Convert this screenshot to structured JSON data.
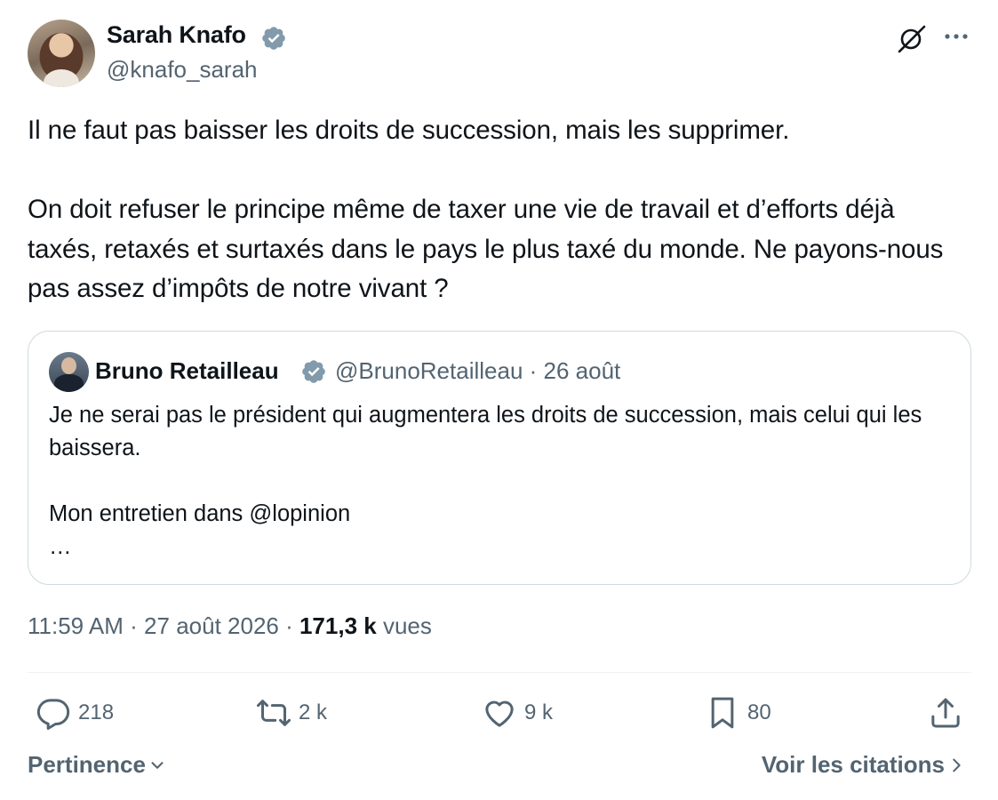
{
  "author": {
    "name": "Sarah Knafo",
    "handle": "@knafo_sarah"
  },
  "tweet": {
    "paragraphs": [
      "Il ne faut pas baisser les droits de succession, mais les supprimer.",
      "On doit refuser le principe même de taxer une vie de travail et d’efforts déjà taxés, retaxés et surtaxés dans le pays le plus taxé du monde. Ne payons-nous pas assez d’impôts de notre vivant ?"
    ]
  },
  "quoted": {
    "name": "Bruno Retailleau",
    "handle": "@BrunoRetailleau",
    "date": "26 août",
    "separator": " · ",
    "lines": [
      "Je ne serai pas le président qui augmentera les droits de succession, mais celui qui les baissera.",
      "Mon entretien dans @lopinion",
      "…"
    ]
  },
  "meta": {
    "time": "11:59 AM",
    "date": "27 août 2026",
    "views_count": "171,3 k",
    "views_label": "vues",
    "separator": " · "
  },
  "actions": {
    "replies": "218",
    "reposts": "2 k",
    "likes": "9 k",
    "bookmarks": "80"
  },
  "footer": {
    "sort_label": "Pertinence",
    "quotes_link": "Voir les citations"
  },
  "colors": {
    "text_primary": "#0f1419",
    "text_secondary": "#536471",
    "verified_badge": "#829aab",
    "border": "#cfd9de"
  },
  "icons": [
    "verified-icon",
    "grok-icon",
    "more-icon",
    "reply-icon",
    "repost-icon",
    "like-icon",
    "bookmark-icon",
    "share-icon",
    "chevron-down-icon",
    "chevron-right-icon"
  ]
}
